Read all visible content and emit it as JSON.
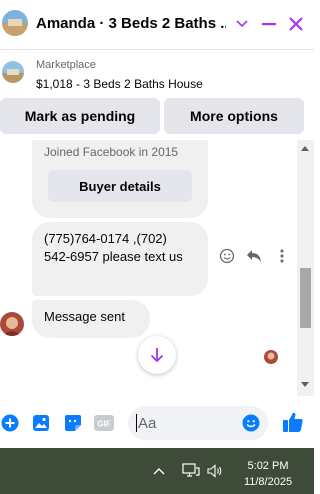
{
  "header": {
    "title": "Amanda · 3 Beds 2 Baths ...",
    "icons": [
      "chevron-down-icon",
      "minimize-icon",
      "close-icon"
    ]
  },
  "marketplace": {
    "kicker": "Marketplace",
    "title": "$1,018 - 3 Beds 2 Baths House"
  },
  "actions": {
    "pending_label": "Mark as pending",
    "more_label": "More options"
  },
  "thread": {
    "joined_text": "Joined Facebook in 2015",
    "buyer_details_label": "Buyer details",
    "messages": [
      "(775)764-0174 ,(702) 542-6957 please text us",
      "Message sent"
    ]
  },
  "composer": {
    "placeholder": "Aa"
  },
  "taskbar": {
    "time": "5:02 PM",
    "date": "11/8/2025"
  },
  "colors": {
    "accent": "#a334fa",
    "like_blue": "#0a7cff",
    "bubble": "#f0f0f0",
    "button_gray": "#e4e6eb",
    "taskbar": "#3e4b38"
  }
}
